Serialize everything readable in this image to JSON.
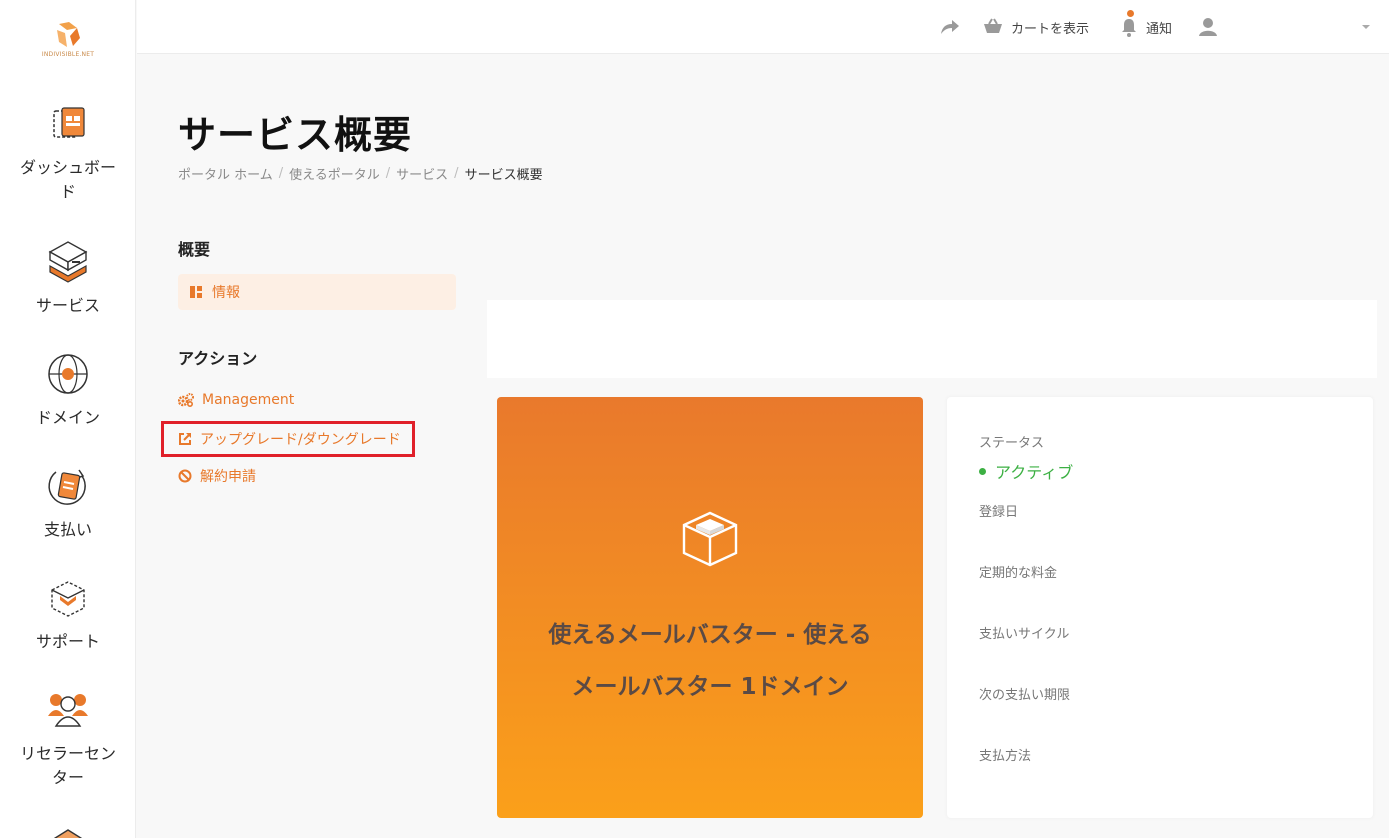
{
  "brand": {
    "logo_text": "INDIVISIBLE.NET",
    "accent": "#e8792b"
  },
  "sidebar": {
    "items": [
      {
        "label": "ダッシュボード",
        "icon": "dashboard-icon"
      },
      {
        "label": "サービス",
        "icon": "service-box-icon"
      },
      {
        "label": "ドメイン",
        "icon": "domain-globe-icon"
      },
      {
        "label": "支払い",
        "icon": "payment-icon"
      },
      {
        "label": "サポート",
        "icon": "support-icon"
      },
      {
        "label": "リセラーセンター",
        "icon": "reseller-icon"
      }
    ]
  },
  "topbar": {
    "share_icon": "share-icon",
    "cart_label": "カートを表示",
    "notify_label": "通知",
    "user_icon": "user-icon"
  },
  "page": {
    "title": "サービス概要",
    "breadcrumb": [
      "ポータル ホーム",
      "使えるポータル",
      "サービス",
      "サービス概要"
    ]
  },
  "menu": {
    "overview_title": "概要",
    "info_label": "情報",
    "actions_title": "アクション",
    "actions": [
      {
        "label": "Management",
        "icon": "gears-icon"
      },
      {
        "label": "アップグレード/ダウングレード",
        "icon": "external-link-icon"
      },
      {
        "label": "解約申請",
        "icon": "ban-icon"
      }
    ]
  },
  "product": {
    "name": "使えるメールバスター - 使えるメールバスター 1ドメイン"
  },
  "details": {
    "status_label": "ステータス",
    "status_value": "アクティブ",
    "status_color": "#3cb043",
    "registered_label": "登録日",
    "recurring_label": "定期的な料金",
    "cycle_label": "支払いサイクル",
    "next_due_label": "次の支払い期限",
    "method_label": "支払方法"
  }
}
